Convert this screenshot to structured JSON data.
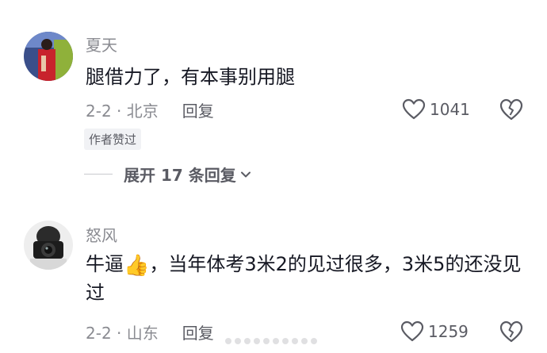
{
  "comments": [
    {
      "username": "夏天",
      "text": "腿借力了，有本事别用腿",
      "date_location": "2-2 · 北京",
      "reply_label": "回复",
      "likes": "1041",
      "badge": "作者赞过",
      "expand_label": "展开 17 条回复"
    },
    {
      "username": "怒风",
      "text_before_emoji": "牛逼",
      "emoji": "👍",
      "text_after_emoji": "，当年体考3米2的见过很多，3米5的还没见过",
      "date_location": "2-2 · 山东",
      "reply_label": "回复",
      "likes": "1259"
    }
  ],
  "icons": {
    "like": "heart-outline-icon",
    "dislike": "broken-heart-icon",
    "expand": "chevron-down-icon"
  }
}
